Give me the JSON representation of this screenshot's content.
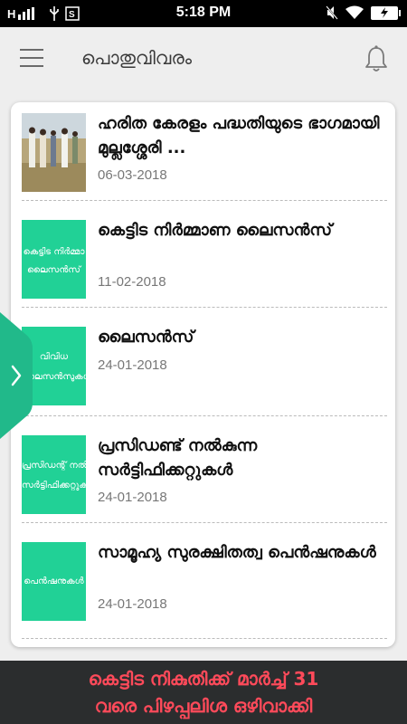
{
  "status_bar": {
    "time": "5:18 PM",
    "battery_icon": "battery-charging-icon"
  },
  "header": {
    "title": "പൊതുവിവരം",
    "menu_icon": "hamburger-menu-icon",
    "notification_icon": "bell-icon"
  },
  "items": [
    {
      "headline": "ഹരിത കേരളം പദ്ധതിയുടെ ഭാഗമായി മുല്ലശ്ശേരി ...",
      "date": "06-03-2018",
      "thumb_text": [
        "",
        ""
      ]
    },
    {
      "headline": "കെട്ടിട നിർമ്മാണ ലൈസൻസ്",
      "date": "11-02-2018",
      "thumb_text": [
        "കെട്ടിട നിർമ്മാ",
        "ലൈസൻസ്"
      ]
    },
    {
      "headline": "ലൈസൻസ്",
      "date": "24-01-2018",
      "thumb_text": [
        "വിവിധ",
        "ലൈസൻസുകൾ"
      ]
    },
    {
      "headline": "പ്രസിഡണ്ട് നൽകുന്ന സർട്ടിഫിക്കറ്റുകൾ",
      "date": "24-01-2018",
      "thumb_text": [
        "പ്രസിഡന്റ് നൽകു",
        "സർട്ടിഫിക്കറ്റുക"
      ]
    },
    {
      "headline": "സാമൂഹ്യ സുരക്ഷിതത്വ പെൻഷനുകൾ",
      "date": "24-01-2018",
      "thumb_text": [
        "പെൻഷനുകൾ",
        ""
      ]
    }
  ],
  "side_tab_icon": "chevron-right-icon",
  "banner": {
    "line1": "കെട്ടിട നികുതിക്ക് മാർച്ച് 31",
    "line2": "വരെ പിഴപ്പലിശ ഒഴിവാക്കി"
  },
  "colors": {
    "accent_teal": "#21d196",
    "banner_bg": "#2b2d2e",
    "banner_text": "#ff4a5a"
  }
}
